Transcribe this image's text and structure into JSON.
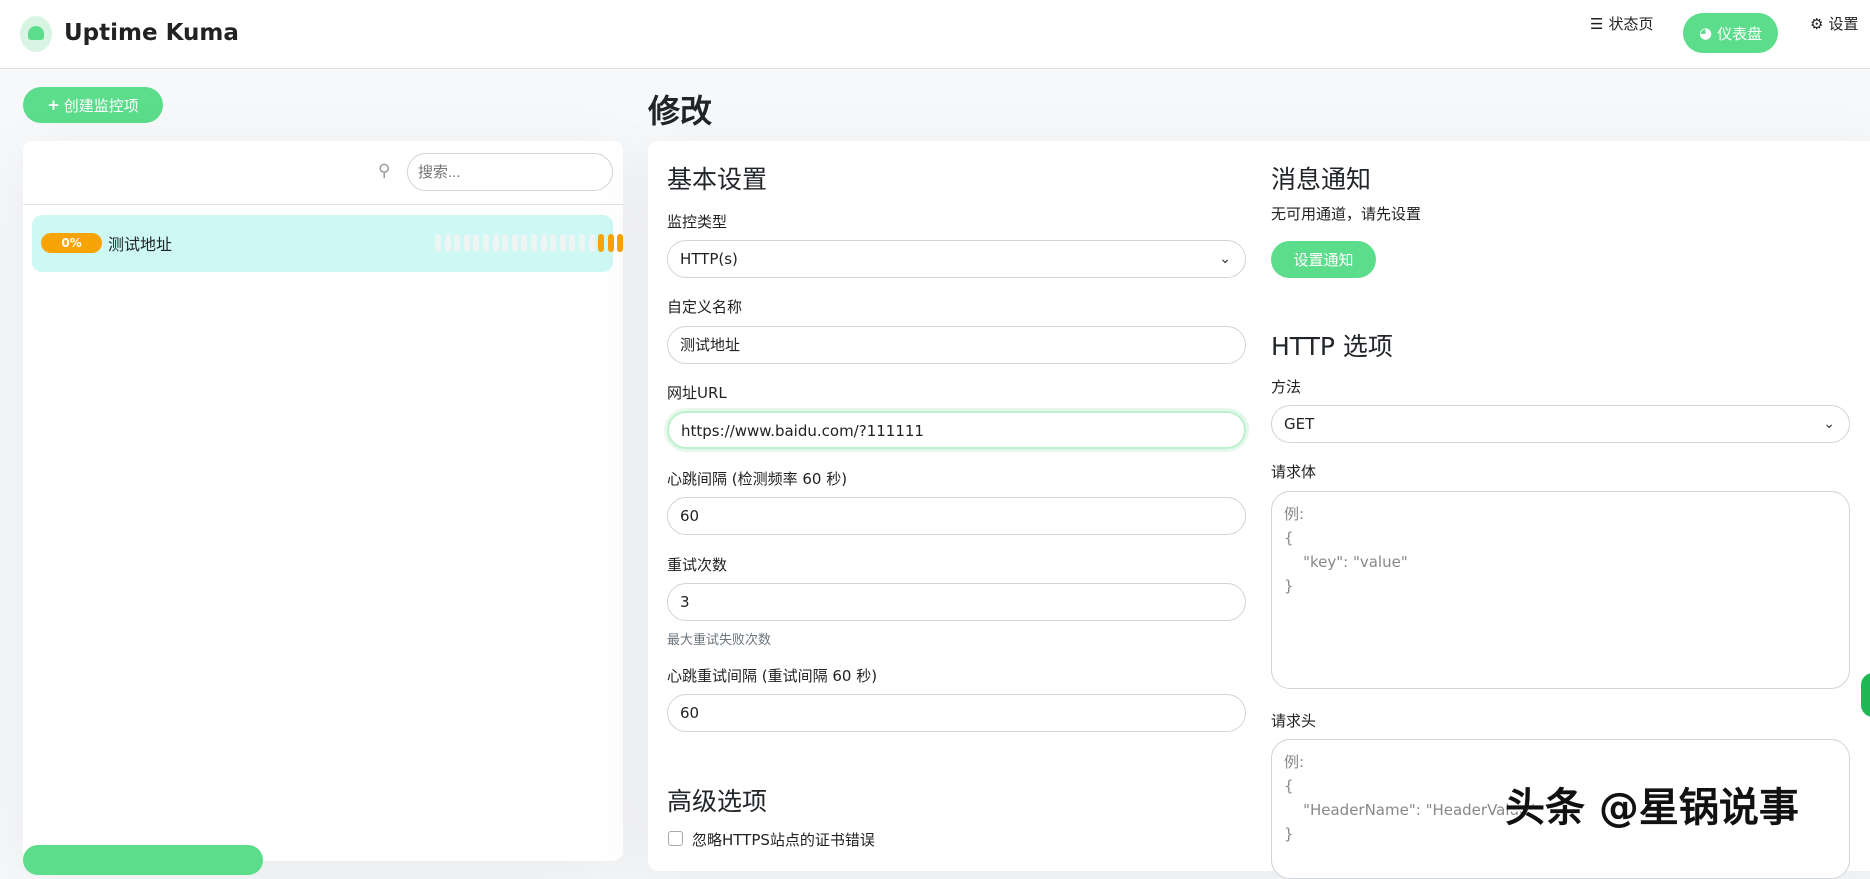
{
  "header": {
    "brand": "Uptime Kuma",
    "nav": [
      {
        "label": "状态页",
        "icon": "list-icon"
      },
      {
        "label": "仪表盘",
        "icon": "dashboard-icon"
      },
      {
        "label": "设置",
        "icon": "gear-icon"
      }
    ]
  },
  "sidebar": {
    "create_label": "创建监控项",
    "search_placeholder": "搜索...",
    "monitors": [
      {
        "uptime": "0%",
        "name": "测试地址"
      }
    ]
  },
  "page": {
    "title": "修改"
  },
  "basic": {
    "heading": "基本设置",
    "type_label": "监控类型",
    "type_value": "HTTP(s)",
    "name_label": "自定义名称",
    "name_value": "测试地址",
    "url_label": "网址URL",
    "url_value": "https://www.baidu.com/?111111",
    "interval_label": "心跳间隔 (检测频率 60 秒)",
    "interval_value": "60",
    "retries_label": "重试次数",
    "retries_value": "3",
    "retries_help": "最大重试失败次数",
    "retry_interval_label": "心跳重试间隔 (重试间隔 60 秒)",
    "retry_interval_value": "60"
  },
  "advanced": {
    "heading": "高级选项",
    "ignore_tls_label": "忽略HTTPS站点的证书错误"
  },
  "notify": {
    "heading": "消息通知",
    "empty_text": "无可用通道，请先设置",
    "setup_label": "设置通知"
  },
  "http": {
    "heading": "HTTP 选项",
    "method_label": "方法",
    "method_value": "GET",
    "body_label": "请求体",
    "body_placeholder": "例:\n{\n    \"key\": \"value\"\n}",
    "headers_label": "请求头",
    "headers_placeholder": "例:\n{\n    \"HeaderName\": \"HeaderValue\"\n}"
  },
  "watermark": "头条 @星锅说事",
  "colors": {
    "accent": "#5cdd8b",
    "pending": "#f8a306",
    "selected": "#cdf8f4"
  }
}
